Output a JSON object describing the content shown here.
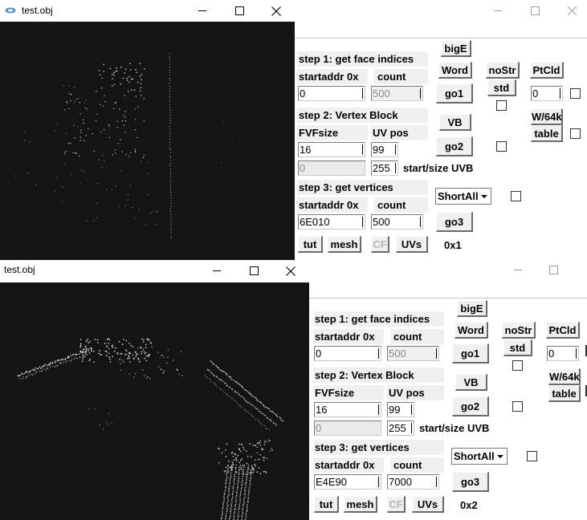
{
  "window_top": {
    "title": "test.obj",
    "panel": {
      "btn_bigE": "bigE",
      "btn_word": "Word",
      "btn_nostr": "noStr",
      "btn_ptcld": "PtCld",
      "btn_std": "std",
      "btn_w64k": "W/64k",
      "btn_table": "table",
      "step1": "step 1: get face indices",
      "startaddr_lbl": "startaddr 0x",
      "count_lbl": "count",
      "f_start1": "0",
      "f_count1": "500",
      "btn_go1": "go1",
      "f_ptcld": "0",
      "step2": "step 2: Vertex Block",
      "btn_vb": "VB",
      "fvf_lbl": "FVFsize",
      "uvpos_lbl": "UV pos",
      "f_fvf": "16",
      "f_uvpos": "99",
      "btn_go2": "go2",
      "f_uvb_start": "0",
      "f_uvb_size": "255",
      "uvb_lbl": "start/size UVB",
      "step3": "step 3: get vertices",
      "combo": "ShortAll",
      "startaddr3_lbl": "startaddr 0x",
      "count3_lbl": "count",
      "f_start3": "6E010",
      "f_count3": "500",
      "btn_go3": "go3",
      "btn_tut": "tut",
      "btn_mesh": "mesh",
      "btn_cf": "CF",
      "btn_uvs": "UVs",
      "result": "0x1"
    }
  },
  "window_bottom": {
    "title": "test.obj",
    "panel": {
      "btn_bigE": "bigE",
      "btn_word": "Word",
      "btn_nostr": "noStr",
      "btn_ptcld": "PtCld",
      "btn_std": "std",
      "btn_w64k": "W/64k",
      "btn_table": "table",
      "step1": "step 1: get face indices",
      "startaddr_lbl": "startaddr 0x",
      "count_lbl": "count",
      "f_start1": "0",
      "f_count1": "500",
      "btn_go1": "go1",
      "f_ptcld": "0",
      "step2": "step 2: Vertex Block",
      "btn_vb": "VB",
      "fvf_lbl": "FVFsize",
      "uvpos_lbl": "UV pos",
      "f_fvf": "16",
      "f_uvpos": "99",
      "btn_go2": "go2",
      "f_uvb_start": "0",
      "f_uvb_size": "255",
      "uvb_lbl": "start/size UVB",
      "step3": "step 3: get vertices",
      "combo": "ShortAll",
      "startaddr3_lbl": "startaddr 0x",
      "count3_lbl": "count",
      "f_start3": "E4E90",
      "f_count3": "7000",
      "btn_go3": "go3",
      "btn_tut": "tut",
      "btn_mesh": "mesh",
      "btn_cf": "CF",
      "btn_uvs": "UVs",
      "result": "0x2"
    }
  },
  "icons": {
    "app": "app-icon",
    "minimize": "minimize-icon",
    "maximize": "maximize-icon",
    "close": "close-icon"
  },
  "colors": {
    "viewport_bg": "#141414",
    "points": "#e6e6e6",
    "control_face": "#f0f0f0"
  }
}
